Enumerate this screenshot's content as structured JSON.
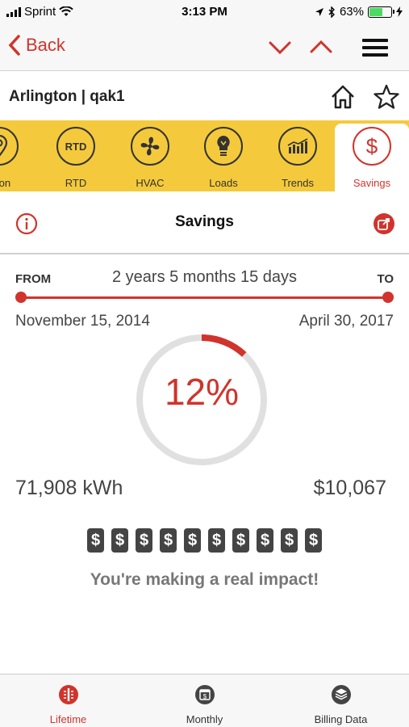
{
  "status_bar": {
    "carrier": "Sprint",
    "time": "3:13 PM",
    "battery_percent": "63%",
    "battery_level": 0.63
  },
  "nav": {
    "back_label": "Back"
  },
  "site": {
    "title": "Arlington | qak1"
  },
  "tabs": [
    {
      "label": "ation",
      "icon": "location-icon",
      "active": false
    },
    {
      "label": "RTD",
      "icon": "rtd-icon",
      "icon_text": "RTD",
      "active": false
    },
    {
      "label": "HVAC",
      "icon": "fan-icon",
      "active": false
    },
    {
      "label": "Loads",
      "icon": "bulb-icon",
      "active": false
    },
    {
      "label": "Trends",
      "icon": "trends-icon",
      "active": false
    },
    {
      "label": "Savings",
      "icon": "dollar-icon",
      "icon_text": "$",
      "active": true
    }
  ],
  "savings": {
    "title": "Savings",
    "from_label": "FROM",
    "to_label": "TO",
    "duration": "2 years 5 months 15 days",
    "start_date": "November 15, 2014",
    "end_date": "April 30, 2017",
    "percent_label": "12%",
    "percent_value": 12,
    "kwh": "71,908 kWh",
    "money": "$10,067",
    "dollar_symbol": "$",
    "dollar_count": 10,
    "message": "You're making a real impact!"
  },
  "bottom_tabs": [
    {
      "label": "Lifetime",
      "icon": "lifetime-icon",
      "active": true
    },
    {
      "label": "Monthly",
      "icon": "calendar-dollar-icon",
      "active": false
    },
    {
      "label": "Billing Data",
      "icon": "billing-stack-icon",
      "active": false
    }
  ],
  "colors": {
    "accent": "#d0342c",
    "tab_strip": "#f4ca3c",
    "gauge_track": "#e0e0e0"
  }
}
